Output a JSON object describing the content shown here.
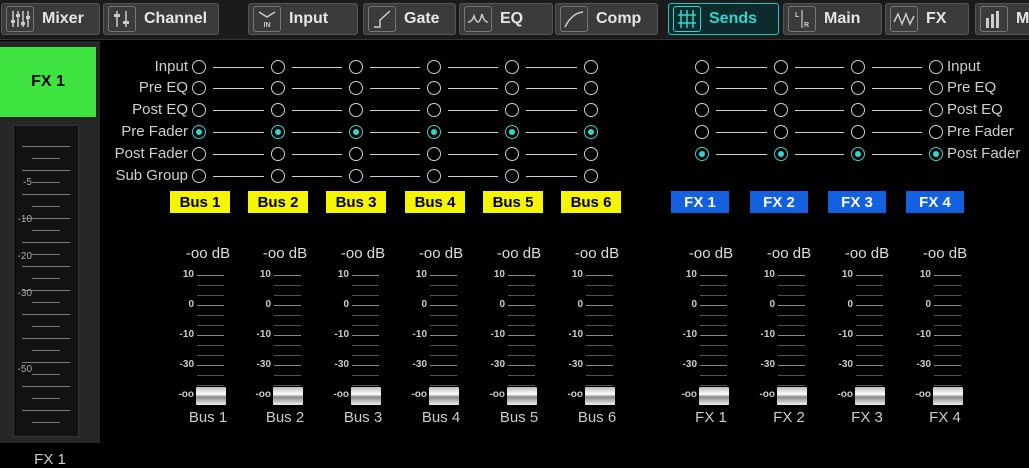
{
  "tabs": [
    {
      "label": "Mixer",
      "icon": "mixer-icon",
      "active": false
    },
    {
      "label": "Channel",
      "icon": "channel-icon",
      "active": false
    },
    {
      "label": "Input",
      "icon": "input-icon",
      "active": false
    },
    {
      "label": "Gate",
      "icon": "gate-icon",
      "active": false
    },
    {
      "label": "EQ",
      "icon": "eq-icon",
      "active": false
    },
    {
      "label": "Comp",
      "icon": "comp-icon",
      "active": false
    },
    {
      "label": "Sends",
      "icon": "sends-icon",
      "active": true
    },
    {
      "label": "Main",
      "icon": "main-icon",
      "active": false
    },
    {
      "label": "FX",
      "icon": "fx-icon",
      "active": false
    },
    {
      "label": "M",
      "icon": "meter-icon",
      "active": false
    }
  ],
  "channel": {
    "name": "FX 1",
    "label": "FX 1",
    "color": "#3fe33f",
    "scale": [
      "-5",
      "-10",
      "-20",
      "-30",
      "-50"
    ]
  },
  "tap_points_bus": [
    "Input",
    "Pre EQ",
    "Post EQ",
    "Pre Fader",
    "Post Fader",
    "Sub Group"
  ],
  "tap_points_fx": [
    "Input",
    "Pre EQ",
    "Post EQ",
    "Pre Fader",
    "Post Fader"
  ],
  "buses": [
    {
      "name": "Bus 1",
      "label": "Bus 1",
      "level": "-oo dB",
      "selected": "Pre Fader"
    },
    {
      "name": "Bus 2",
      "label": "Bus 2",
      "level": "-oo dB",
      "selected": "Pre Fader"
    },
    {
      "name": "Bus 3",
      "label": "Bus 3",
      "level": "-oo dB",
      "selected": "Pre Fader"
    },
    {
      "name": "Bus 4",
      "label": "Bus 4",
      "level": "-oo dB",
      "selected": "Pre Fader"
    },
    {
      "name": "Bus 5",
      "label": "Bus 5",
      "level": "-oo dB",
      "selected": "Pre Fader"
    },
    {
      "name": "Bus 6",
      "label": "Bus 6",
      "level": "-oo dB",
      "selected": "Pre Fader"
    }
  ],
  "fx_sends": [
    {
      "name": "FX 1",
      "label": "FX 1",
      "level": "-oo dB",
      "selected": "Post Fader"
    },
    {
      "name": "FX 2",
      "label": "FX 2",
      "level": "-oo dB",
      "selected": "Post Fader"
    },
    {
      "name": "FX 3",
      "label": "FX 3",
      "level": "-oo dB",
      "selected": "Post Fader"
    },
    {
      "name": "FX 4",
      "label": "FX 4",
      "level": "-oo dB",
      "selected": "Post Fader"
    }
  ],
  "fader_scale": [
    "10",
    "0",
    "-10",
    "-30",
    "-oo"
  ],
  "colors": {
    "accent": "#2fd6cf",
    "bus_yellow": "#f5f500",
    "fx_blue": "#1360e0"
  }
}
